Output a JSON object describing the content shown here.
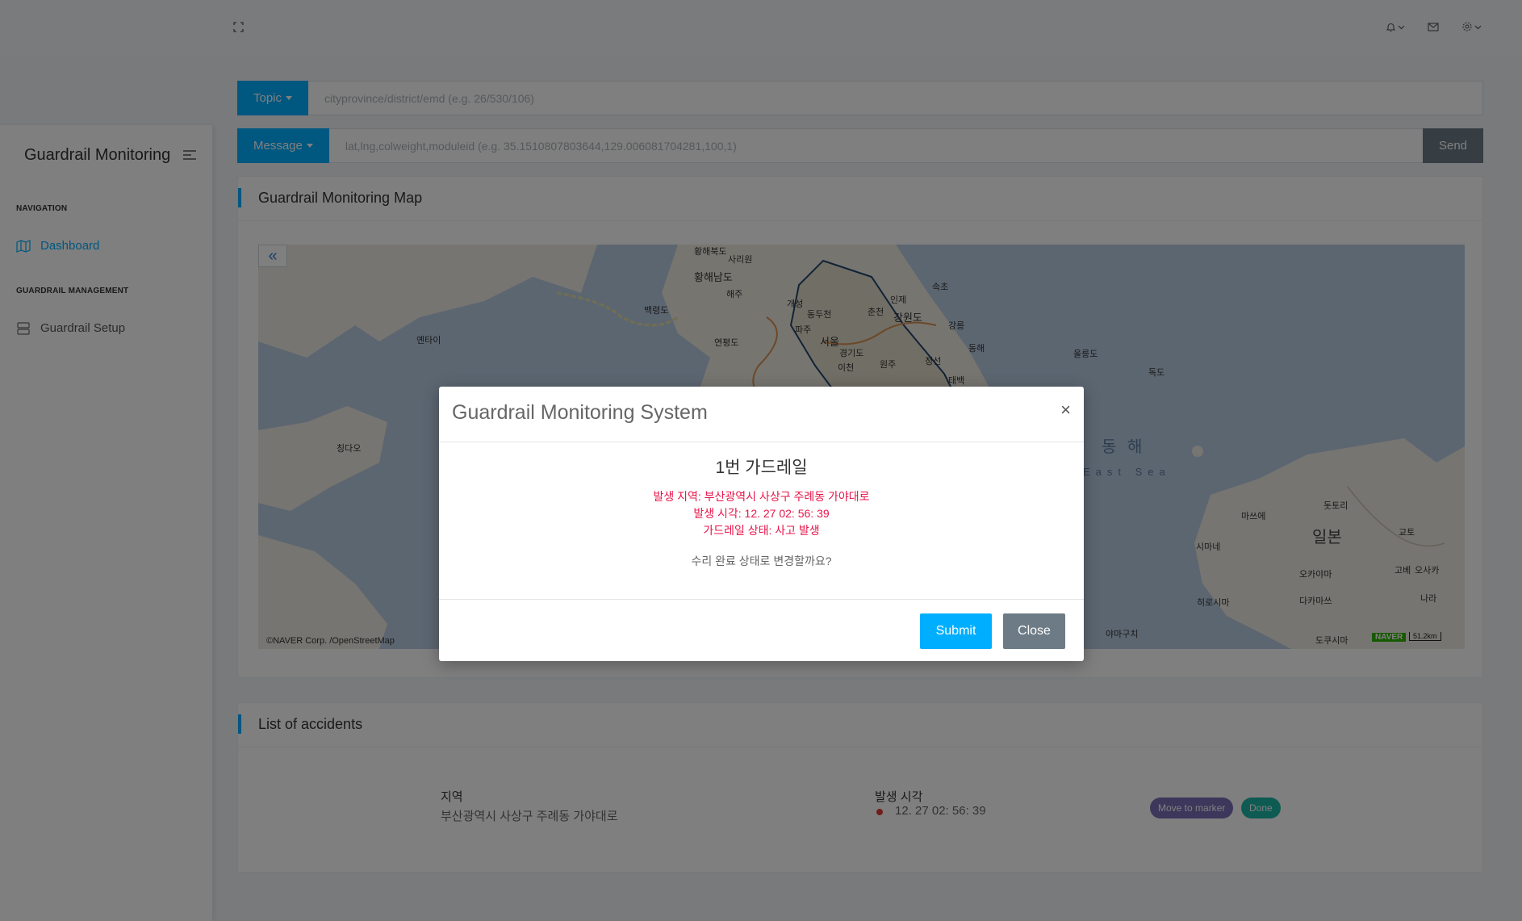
{
  "header": {
    "expand_icon": "expand-icon",
    "icons": [
      "bell-icon",
      "mail-icon",
      "gear-icon"
    ]
  },
  "sidebar": {
    "brand": "Guardrail Monitoring",
    "nav_heading": "NAVIGATION",
    "items": [
      {
        "label": "Dashboard",
        "icon": "map-icon",
        "active": true
      }
    ],
    "management_heading": "GUARDRAIL MANAGEMENT",
    "management_items": [
      {
        "label": "Guardrail Setup",
        "icon": "server-icon"
      }
    ]
  },
  "topic": {
    "button_label": "Topic",
    "placeholder": "cityprovince/district/emd (e.g. 26/530/106)"
  },
  "message": {
    "button_label": "Message",
    "placeholder": "lat,lng,colweight,moduleid (e.g. 35.1510807803644,129.006081704281,100,1)",
    "send_label": "Send"
  },
  "map_card": {
    "title": "Guardrail Monitoring Map",
    "credit": "©NAVER Corp. /OpenStreetMap",
    "naver_logo": "NAVER",
    "scale": "51.2km",
    "labels": [
      "황해북도",
      "사리원",
      "황해남도",
      "해주",
      "개성",
      "백령도",
      "연평도",
      "옌타이",
      "칭다오",
      "동두천",
      "파주",
      "춘천",
      "인제",
      "속초",
      "강원도",
      "강릉",
      "동해",
      "울릉도",
      "독도",
      "서울",
      "경기도",
      "이천",
      "원주",
      "정선",
      "태백",
      "동 해",
      "East Sea",
      "일본",
      "돗토리",
      "마쓰에",
      "교토",
      "시마네",
      "고베",
      "오사카",
      "오카야마",
      "나라",
      "히로시마",
      "다카마쓰",
      "야마구치",
      "도쿠시마"
    ]
  },
  "accidents_card": {
    "title": "List of accidents",
    "col_region": "지역",
    "col_time": "발생 시각",
    "rows": [
      {
        "region": "부산광역시 사상구 주례동 가야대로",
        "time": "12. 27 02: 56: 39",
        "move_label": "Move to marker",
        "done_label": "Done"
      }
    ],
    "colors": {
      "move": "#7b6fb8",
      "done": "#1bb7a6",
      "dot": "#e53935"
    }
  },
  "modal": {
    "title": "Guardrail Monitoring System",
    "close_glyph": "×",
    "heading": "1번 가드레일",
    "location": "발생 지역: 부산광역시 사상구 주례동 가야대로",
    "time": "발생 시각: 12. 27 02: 56: 39",
    "status": "가드레일 상태: 사고 발생",
    "question": "수리 완료 상태로 변경할까요?",
    "submit_label": "Submit",
    "close_label": "Close"
  },
  "colors": {
    "accent": "#00aeff",
    "secondary": "#6c7b86"
  }
}
